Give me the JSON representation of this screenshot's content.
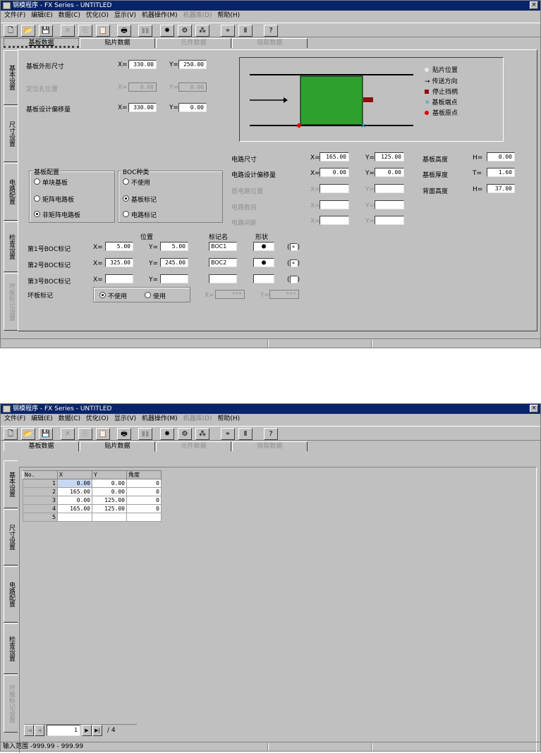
{
  "window": {
    "title": "钢模程序 - FX Series - UNTITLED",
    "close": "×"
  },
  "menu": [
    {
      "label": "文件(F)",
      "enabled": true
    },
    {
      "label": "编辑(E)",
      "enabled": true
    },
    {
      "label": "数据(C)",
      "enabled": true
    },
    {
      "label": "优化(O)",
      "enabled": true
    },
    {
      "label": "显示(V)",
      "enabled": true
    },
    {
      "label": "机器操作(M)",
      "enabled": true
    },
    {
      "label": "机器库(D)",
      "enabled": false
    },
    {
      "label": "帮助(H)",
      "enabled": true
    }
  ],
  "toolbar": [
    {
      "icon": "new-icon",
      "glyph": "🗋",
      "enabled": true
    },
    {
      "icon": "open-icon",
      "glyph": "📂",
      "enabled": true
    },
    {
      "icon": "save-icon",
      "glyph": "💾",
      "enabled": true
    },
    {
      "icon": "cut-icon",
      "glyph": "✕",
      "enabled": false
    },
    {
      "icon": "copy-icon",
      "glyph": "⎘",
      "enabled": false
    },
    {
      "icon": "paste-icon",
      "glyph": "📋",
      "enabled": false
    },
    {
      "icon": "print-icon",
      "glyph": "🖶",
      "enabled": true
    },
    {
      "icon": "view-icon",
      "glyph": "▮▮",
      "enabled": false
    },
    {
      "icon": "light-icon",
      "glyph": "✹",
      "enabled": true
    },
    {
      "icon": "machine-icon",
      "glyph": "⚙",
      "enabled": true
    },
    {
      "icon": "components-icon",
      "glyph": "⁂",
      "enabled": true
    },
    {
      "icon": "mark-icon",
      "glyph": "⌖",
      "enabled": true
    },
    {
      "icon": "pause-icon",
      "glyph": "Ⅱ",
      "enabled": true
    },
    {
      "icon": "help-icon",
      "glyph": "?",
      "enabled": true
    }
  ],
  "tabs": [
    {
      "label": "基板数据",
      "selected": true,
      "enabled": true
    },
    {
      "label": "贴片数据",
      "selected": false,
      "enabled": true
    },
    {
      "label": "元件数据",
      "selected": false,
      "enabled": false
    },
    {
      "label": "吸取数据",
      "selected": false,
      "enabled": false
    }
  ],
  "screen1": {
    "sidetabs": [
      {
        "label": "基本设置",
        "enabled": true,
        "selected": false
      },
      {
        "label": "尺寸设置",
        "enabled": true,
        "selected": true
      },
      {
        "label": "电路配置",
        "enabled": true,
        "selected": false
      },
      {
        "label": "检查设置",
        "enabled": true,
        "selected": false
      },
      {
        "label": "坏板标记设置",
        "enabled": false,
        "selected": false
      }
    ],
    "board_size": {
      "label": "基板外形尺寸",
      "x_label": "X=",
      "x": "330.00",
      "y_label": "Y=",
      "y": "250.00"
    },
    "position": {
      "label": "定位孔位置",
      "x_label": "X=",
      "x": "0.00",
      "y_label": "Y=",
      "y": "0.00"
    },
    "design_offset": {
      "label": "基板设计偏移量",
      "x_label": "X=",
      "x": "330.00",
      "y_label": "Y=",
      "y": "0.00"
    },
    "legend": [
      {
        "label": "贴片位置",
        "icon": "circle-white-icon"
      },
      {
        "label": "传送方向",
        "icon": "arrow-right-icon"
      },
      {
        "label": "停止挡柄",
        "icon": "stop-block-icon"
      },
      {
        "label": "基板端点",
        "icon": "cross-icon"
      },
      {
        "label": "基板原点",
        "icon": "red-dot-icon"
      }
    ],
    "circuit": {
      "size_label": "电路尺寸",
      "size_x": "165.00",
      "size_y": "125.00",
      "offset_label": "电路设计偏移量",
      "offset_x": "0.00",
      "offset_y": "0.00",
      "first_label": "首电路位置",
      "first_x": "",
      "first_y": "",
      "count_label": "电路数目",
      "count_x": "",
      "count_y": "",
      "pitch_label": "电路间距",
      "pitch_x": "",
      "pitch_y": "",
      "x_label": "X=",
      "y_label": "Y="
    },
    "heights": {
      "board_height_label": "基板高度",
      "board_height_key": "H=",
      "board_height": "0.00",
      "board_thick_label": "基板厚度",
      "board_thick_key": "T=",
      "board_thick": "1.60",
      "back_height_label": "背面高度",
      "back_height_key": "H=",
      "back_height": "37.00"
    },
    "board_config": {
      "title": "基板配置",
      "options": [
        "单块基板",
        "矩阵电路板",
        "非矩阵电路板"
      ],
      "selected": 2
    },
    "boc_type": {
      "title": "BOC种类",
      "options": [
        "不使用",
        "基板标记",
        "电路标记"
      ],
      "selected": 1
    },
    "boc_headers": {
      "pos": "位置",
      "name": "标记名",
      "shape": "形状"
    },
    "boc_rows": [
      {
        "label": "第1号BOC标记",
        "x_label": "X=",
        "x": "5.00",
        "y_label": "Y=",
        "y": "5.00",
        "name": "BOC1",
        "shape": "●",
        "shape_sel": "*"
      },
      {
        "label": "第2号BOC标记",
        "x_label": "X=",
        "x": "325.00",
        "y_label": "Y=",
        "y": "245.00",
        "name": "BOC2",
        "shape": "●",
        "shape_sel": "*"
      },
      {
        "label": "第3号BOC标记",
        "x_label": "X=",
        "x": "",
        "y_label": "Y=",
        "y": "",
        "name": "",
        "shape": "",
        "shape_sel": ""
      }
    ],
    "bad_mark": {
      "label": "坏板标记",
      "opt1": "不使用",
      "opt2": "使用",
      "selected": 0,
      "x_label": "X=",
      "x": "***",
      "y_label": "Y=",
      "y": "***"
    },
    "status": ""
  },
  "screen2": {
    "sidetabs": [
      {
        "label": "基本设置",
        "enabled": true,
        "selected": false
      },
      {
        "label": "尺寸设置",
        "enabled": true,
        "selected": false
      },
      {
        "label": "电路配置",
        "enabled": true,
        "selected": true
      },
      {
        "label": "检查设置",
        "enabled": true,
        "selected": false
      },
      {
        "label": "坏板标记设置",
        "enabled": false,
        "selected": false
      }
    ],
    "grid_headers": [
      "No.",
      "X",
      "Y",
      "角度"
    ],
    "grid_rows": [
      [
        "1",
        "0.00",
        "0.00",
        "0"
      ],
      [
        "2",
        "165.00",
        "0.00",
        "0"
      ],
      [
        "3",
        "0.00",
        "125.00",
        "0"
      ],
      [
        "4",
        "165.00",
        "125.00",
        "0"
      ],
      [
        "5",
        "",
        "",
        ""
      ]
    ],
    "page_current": "1",
    "page_total": "/ 4",
    "status": "输入范围 -999.99 - 999.99"
  }
}
